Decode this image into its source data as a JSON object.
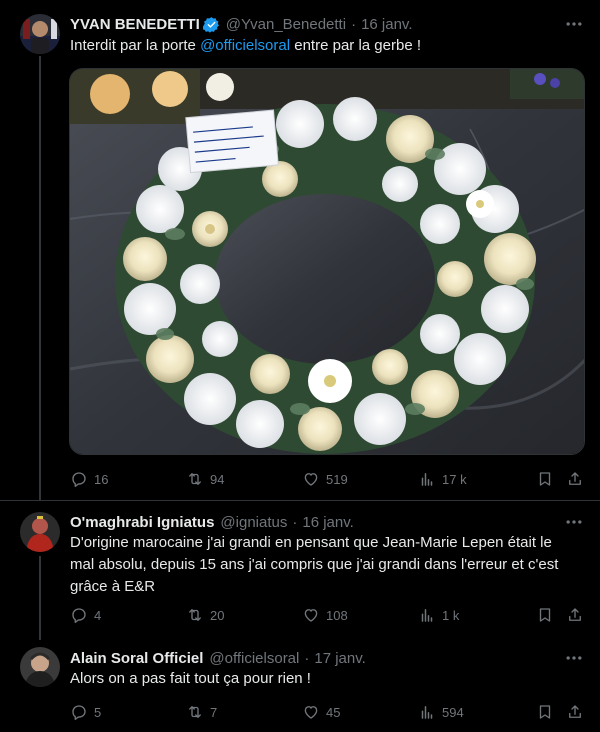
{
  "tweets": [
    {
      "author": {
        "name": "YVAN BENEDETTI",
        "handle": "@Yvan_Benedetti",
        "verified": true
      },
      "date": "16 janv.",
      "text_before": "Interdit par la porte ",
      "mention": "@officielsoral",
      "text_after": " entre par la gerbe !",
      "media": {
        "card_note": "Merci pour la gerbe du travail à la mairie de vidéo !"
      },
      "stats": {
        "replies": "16",
        "reposts": "94",
        "likes": "519",
        "views": "17 k"
      }
    },
    {
      "author": {
        "name": "O'maghrabi Igniatus",
        "handle": "@igniatus"
      },
      "date": "16 janv.",
      "text": "D'origine marocaine j'ai grandi en pensant que Jean-Marie Lepen était le mal absolu, depuis 15 ans j'ai compris que j'ai grandi dans l'erreur et c'est grâce à E&R",
      "stats": {
        "replies": "4",
        "reposts": "20",
        "likes": "108",
        "views": "1 k"
      }
    },
    {
      "author": {
        "name": "Alain Soral Officiel",
        "handle": "@officielsoral"
      },
      "date": "17 janv.",
      "text": "Alors on a pas fait tout ça pour rien !",
      "stats": {
        "replies": "5",
        "reposts": "7",
        "likes": "45",
        "views": "594"
      }
    }
  ],
  "colors": {
    "background": "#000000",
    "text": "#e7e9ea",
    "muted": "#71767b",
    "accent": "#1d9bf0",
    "border": "#2f3336"
  },
  "icons": [
    "more-icon",
    "verified-icon",
    "reply-icon",
    "repost-icon",
    "like-icon",
    "views-icon",
    "bookmark-icon",
    "share-icon"
  ],
  "separator_dot": "·"
}
